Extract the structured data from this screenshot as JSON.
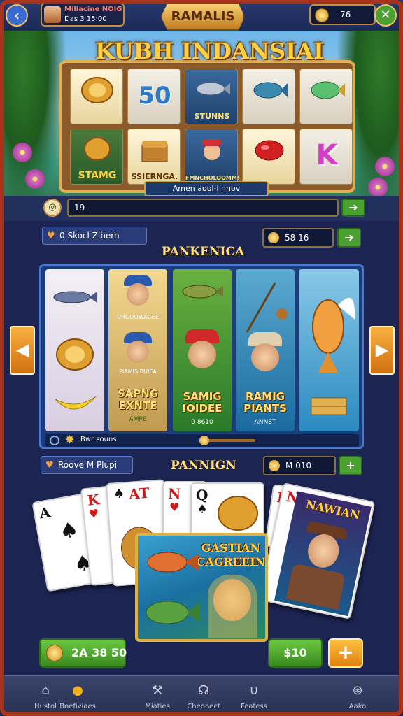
{
  "top_bar": {
    "brand": "RAMALIS",
    "profile_name": "Millacine NOIG",
    "profile_time": "Das 3 15:00",
    "coins": "76"
  },
  "hero": {
    "title": "KUBH INDANSIAI",
    "reel_labels": [
      "STAMG",
      "SSIERNGA.",
      "STUNNS",
      "FMNCHOLOOMMS"
    ],
    "reel_number": "50",
    "reel_letter": "K",
    "banner": "Amen aool-l nnov"
  },
  "search": {
    "value": "19"
  },
  "section1": {
    "pill": "0 Skocl Zlbern",
    "title": "PANKENICA",
    "coins": "58 16",
    "columns": [
      {
        "title": "",
        "sub": ""
      },
      {
        "title": "SAPNG EXNTE",
        "sub": "AMPE",
        "top_label": "UHGOOWAGEE",
        "mid_label": "PIAMIS BUIEA"
      },
      {
        "title": "SAMIG IOIDEE",
        "sub": "9 8610"
      },
      {
        "title": "RAMIG PIANTS",
        "sub": "ANNST"
      },
      {
        "title": "",
        "sub": ""
      }
    ],
    "footer_text": "Bwr souns"
  },
  "section2": {
    "pill": "Roove M Plupi",
    "title": "PANNIGN",
    "coins": "M 010",
    "cards": [
      "A",
      "K",
      "AT",
      "N",
      "Q",
      "K",
      "N"
    ],
    "featured_title": "GASTIAN CAGREEIN",
    "woman_title": "NAWIAN"
  },
  "actions": {
    "balance": "2A 38 50",
    "bet": "$10",
    "plus": "+"
  },
  "nav": [
    {
      "label": "Hustol",
      "icon": "home-icon"
    },
    {
      "label": "Boefiviaes",
      "icon": "coin-icon"
    },
    {
      "label": "Miaties",
      "icon": "tools-icon"
    },
    {
      "label": "Cheonect",
      "icon": "support-icon"
    },
    {
      "label": "Featess",
      "icon": "shield-icon"
    },
    {
      "label": "Aako",
      "icon": "settings-icon"
    }
  ]
}
